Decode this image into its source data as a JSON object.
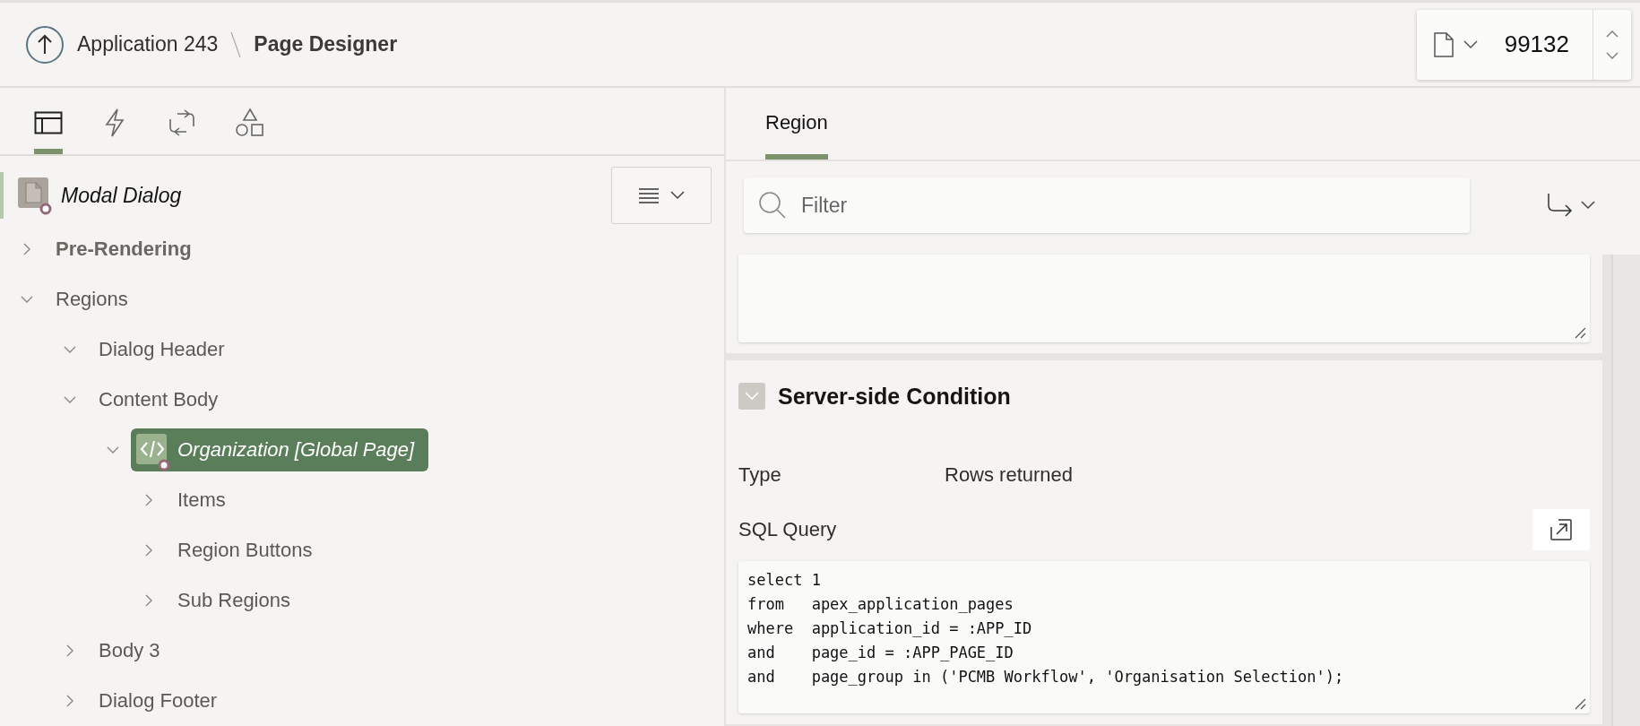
{
  "header": {
    "breadcrumb": [
      {
        "label": "Application 243",
        "current": false
      },
      {
        "label": "Page Designer",
        "current": true
      }
    ],
    "page_number": "99132"
  },
  "left_tabs": [
    {
      "kind": "rendering",
      "selected": true
    },
    {
      "kind": "dynamic-actions",
      "selected": false
    },
    {
      "kind": "processing",
      "selected": false
    },
    {
      "kind": "shared-components",
      "selected": false
    }
  ],
  "tree": {
    "root": {
      "label": "Modal Dialog",
      "kind": "page"
    },
    "nodes": [
      {
        "label": "Pre-Rendering",
        "kind": "folder",
        "bold": true,
        "expanded": false,
        "selected": false
      },
      {
        "label": "Regions",
        "kind": "folder",
        "bold": false,
        "expanded": true,
        "selected": false,
        "children": [
          {
            "label": "Dialog Header",
            "kind": "folder",
            "bold": false,
            "expanded": true,
            "selected": false
          },
          {
            "label": "Content Body",
            "kind": "folder",
            "bold": false,
            "expanded": true,
            "selected": false,
            "children": [
              {
                "label": "Organization [Global Page]",
                "kind": "region",
                "expanded": true,
                "selected": true,
                "children": [
                  {
                    "label": "Items",
                    "kind": "folder",
                    "bold": false,
                    "expanded": false,
                    "selected": false
                  },
                  {
                    "label": "Region Buttons",
                    "kind": "folder",
                    "bold": false,
                    "expanded": false,
                    "selected": false
                  },
                  {
                    "label": "Sub Regions",
                    "kind": "folder",
                    "bold": false,
                    "expanded": false,
                    "selected": false
                  }
                ]
              }
            ]
          },
          {
            "label": "Body 3",
            "kind": "folder",
            "bold": false,
            "expanded": false,
            "selected": false
          },
          {
            "label": "Dialog Footer",
            "kind": "folder",
            "bold": false,
            "expanded": false,
            "selected": false
          }
        ]
      }
    ]
  },
  "properties": {
    "tabs": [
      {
        "label": "Region",
        "selected": true
      }
    ],
    "filter": {
      "placeholder": "Filter"
    },
    "sections": [
      {
        "title": "Server-side Condition",
        "expanded": true,
        "fields": [
          {
            "kind": "text",
            "label": "Type",
            "value": "Rows returned"
          },
          {
            "kind": "code",
            "label": "SQL Query",
            "value": "select 1\nfrom   apex_application_pages\nwhere  application_id = :APP_ID\nand    page_id = :APP_PAGE_ID\nand    page_group in ('PCMB Workflow', 'Organisation Selection');"
          }
        ]
      }
    ]
  }
}
